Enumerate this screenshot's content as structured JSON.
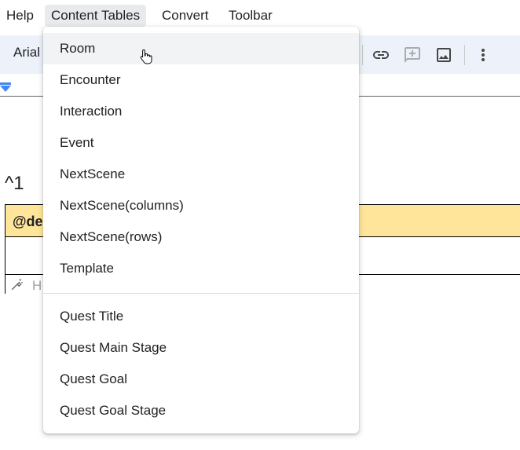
{
  "menubar": {
    "items": [
      {
        "label": "Help"
      },
      {
        "label": "Content Tables"
      },
      {
        "label": "Convert"
      },
      {
        "label": "Toolbar"
      }
    ]
  },
  "toolbar": {
    "font_name": "Arial",
    "icons": [
      "link-icon",
      "add-comment-icon",
      "insert-image-icon",
      "more-vert-icon"
    ]
  },
  "document": {
    "caret_text": "^1",
    "table_header_text": "@de",
    "assist_placeholder": "H"
  },
  "dropdown": {
    "items": [
      {
        "label": "Room"
      },
      {
        "label": "Encounter"
      },
      {
        "label": "Interaction"
      },
      {
        "label": "Event"
      },
      {
        "label": "NextScene"
      },
      {
        "label": "NextScene(columns)"
      },
      {
        "label": "NextScene(rows)"
      },
      {
        "label": "Template"
      },
      {
        "label": "Quest Title"
      },
      {
        "label": "Quest Main Stage"
      },
      {
        "label": "Quest Goal"
      },
      {
        "label": "Quest Goal Stage"
      }
    ]
  },
  "colors": {
    "toolbar_bg": "#edf2fa",
    "table_header_bg": "#ffe599",
    "accent": "#4285f4",
    "menu_active_bg": "#e8eaed",
    "item_hover_bg": "#f1f3f4"
  }
}
